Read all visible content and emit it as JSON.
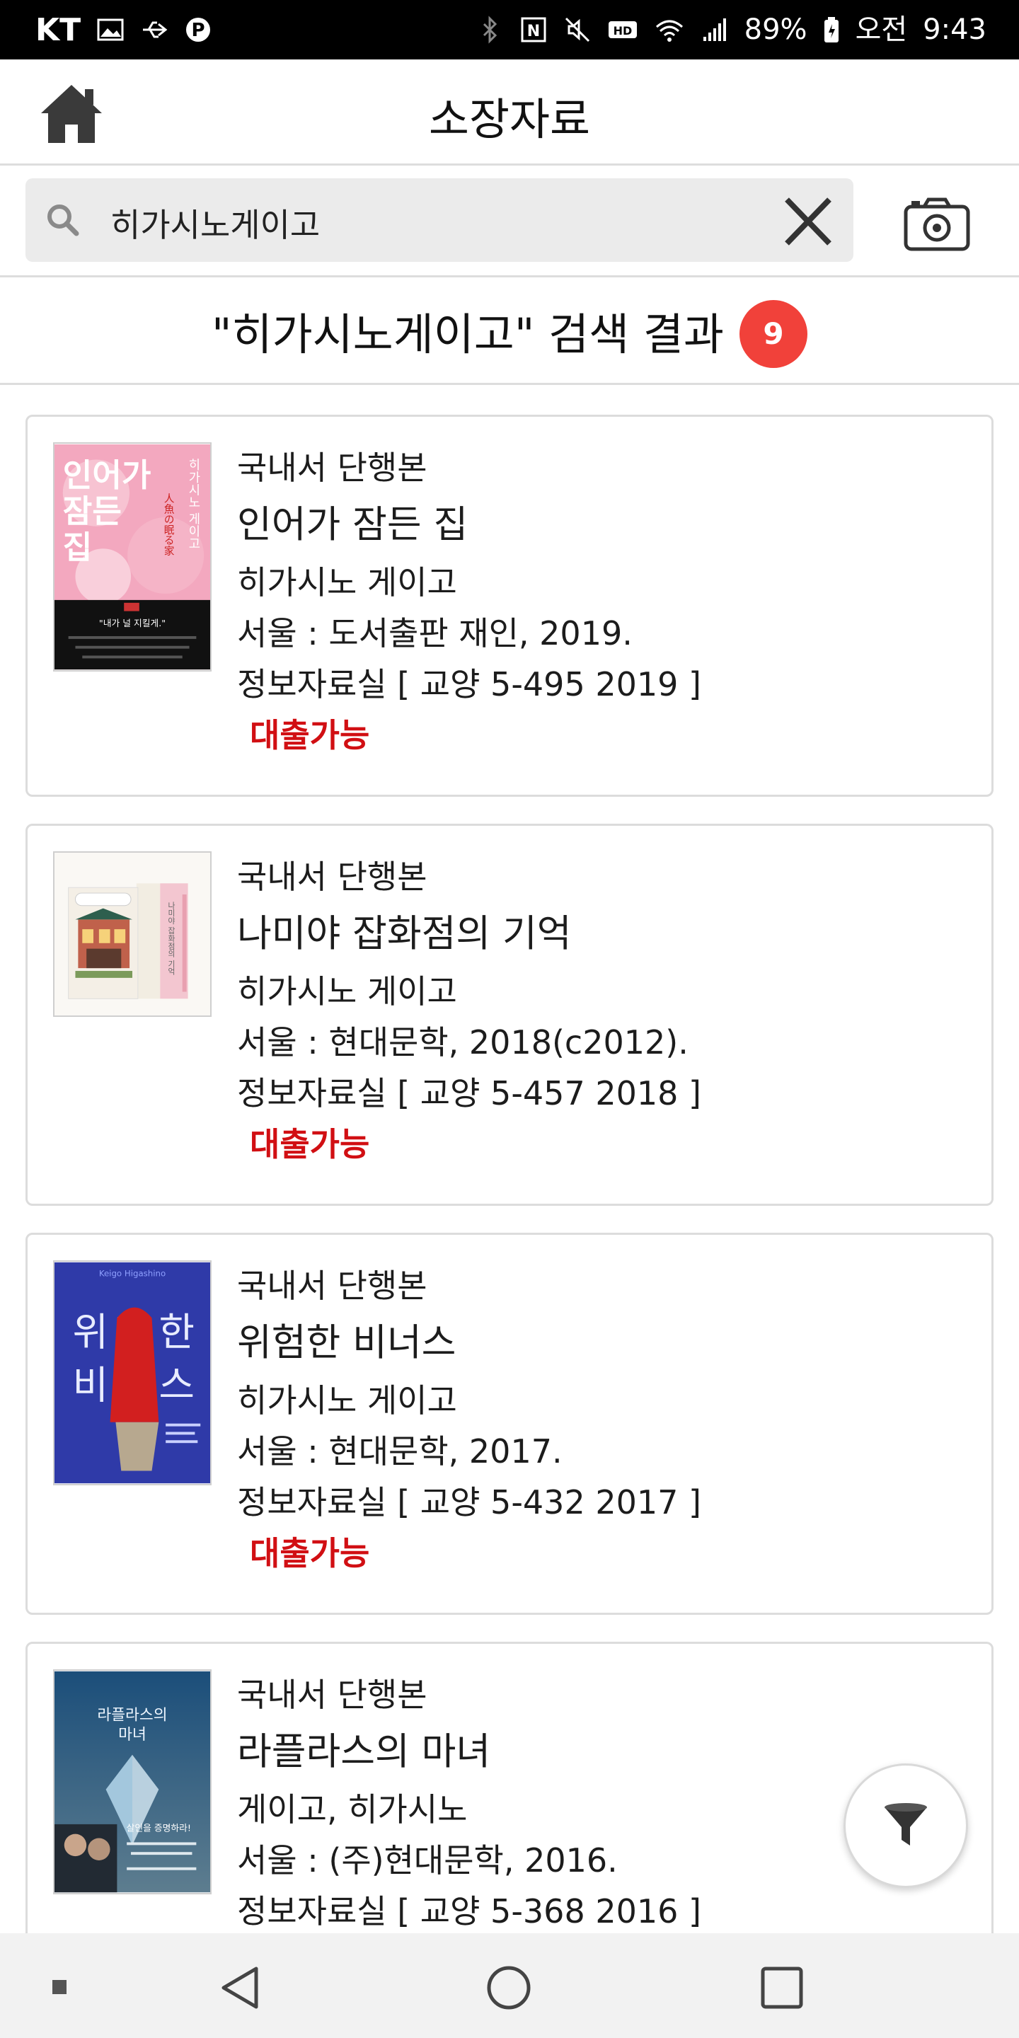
{
  "status_bar": {
    "carrier": "KT",
    "battery": "89%",
    "ampm": "오전",
    "time": "9:43"
  },
  "header": {
    "title": "소장자료"
  },
  "search": {
    "query": "히가시노게이고"
  },
  "results": {
    "title": "\"히가시노게이고\" 검색 결과",
    "count": "9"
  },
  "books": [
    {
      "type": "국내서 단행본",
      "title": "인어가 잠든 집",
      "author": "히가시노 게이고",
      "publication": "서울 : 도서출판 재인, 2019.",
      "location": "정보자료실 [ 교양 5-495 2019 ]",
      "status": "대출가능",
      "cover": {
        "title": "인어가 잠든 집",
        "author": "히가시노 게이고",
        "subtitle": "人魚の眠る家",
        "quote": "\"내가 널 지킬게.\""
      }
    },
    {
      "type": "국내서 단행본",
      "title": "나미야 잡화점의 기억",
      "author": "히가시노 게이고",
      "publication": "서울 : 현대문학, 2018(c2012).",
      "location": "정보자료실 [ 교양 5-457 2018 ]",
      "status": "대출가능",
      "cover": {
        "title": "나미야 잡화점의 기억"
      }
    },
    {
      "type": "국내서 단행본",
      "title": "위험한 비너스",
      "author": "히가시노 게이고",
      "publication": "서울 : 현대문학, 2017.",
      "location": "정보자료실 [ 교양 5-432 2017 ]",
      "status": "대출가능",
      "cover": {
        "title": "위험한 비너스",
        "author_en": "Keigo Higashino"
      }
    },
    {
      "type": "국내서 단행본",
      "title": "라플라스의 마녀",
      "author": "게이고, 히가시노",
      "publication": "서울 : (주)현대문학, 2016.",
      "location": "정보자료실 [ 교양 5-368 2016 ]",
      "cover": {
        "title": "라플라스의 마녀",
        "tagline": "살인을 증명하라!"
      }
    }
  ],
  "colors": {
    "accent_red": "#d10f13",
    "badge_red": "#f1413a",
    "search_bg": "#ebebeb"
  },
  "icons": {
    "home": "home-icon",
    "search": "search-icon",
    "clear": "close-icon",
    "camera": "camera-icon",
    "filter": "filter-icon"
  }
}
